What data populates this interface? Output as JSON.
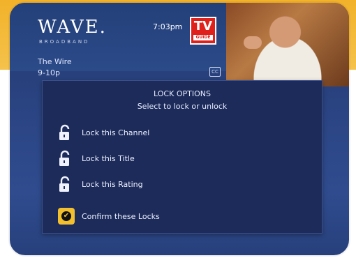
{
  "header": {
    "logo": "WAVE.",
    "logo_sub": "BROADBAND",
    "clock": "7:03pm",
    "tvguide_top": "TV",
    "tvguide_bottom": "GUIDE",
    "cc_icon": "CC"
  },
  "program": {
    "title": "The Wire",
    "time": "9-10p"
  },
  "dialog": {
    "title": "LOCK OPTIONS",
    "subtitle": "Select to lock or unlock",
    "options": [
      {
        "label": "Lock this Channel",
        "icon": "padlock-open-icon"
      },
      {
        "label": "Lock this Title",
        "icon": "padlock-open-icon"
      },
      {
        "label": "Lock this Rating",
        "icon": "padlock-open-icon"
      }
    ],
    "confirm_label": "Confirm these Locks",
    "confirm_icon": "checkmark-icon",
    "confirm_glyph": "✔"
  },
  "colors": {
    "top_band": "#f2b22a",
    "panel_bg": "#1d2b5a",
    "screen_bg": "#2b4584",
    "accent": "#f2c02e",
    "tvguide_red": "#e0211b"
  }
}
